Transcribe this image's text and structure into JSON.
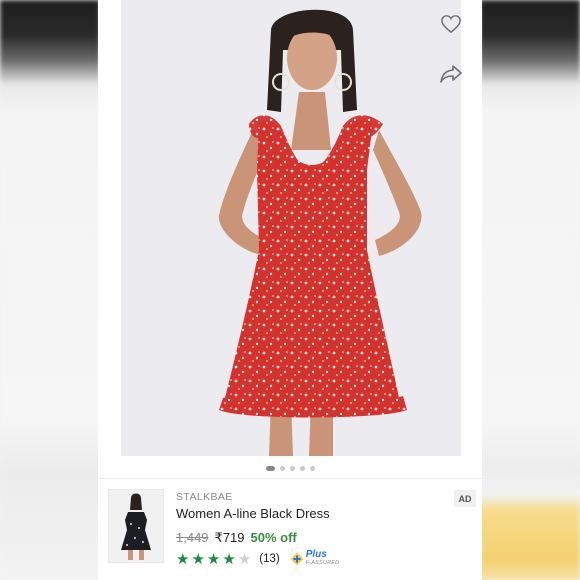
{
  "product": {
    "image_alt": "",
    "image_dots": 5,
    "active_dot": 0
  },
  "icons": {
    "wishlist": "heart-icon",
    "share": "share-icon"
  },
  "ad": {
    "badge": "AD",
    "brand": "STALKBAE",
    "title": "Women A-line Black Dress",
    "mrp": "1,449",
    "price": "₹719",
    "discount": "50% off",
    "rating_stars": 4,
    "rating_max": 5,
    "rating_count": "(13)",
    "assured_plus": "Plus",
    "assured_label": "F-ASSURED"
  },
  "colors": {
    "discount_green": "#388e3c",
    "star_green": "#1f8a3c",
    "assured_blue": "#2874f0",
    "dress_red": "#d3322e"
  }
}
